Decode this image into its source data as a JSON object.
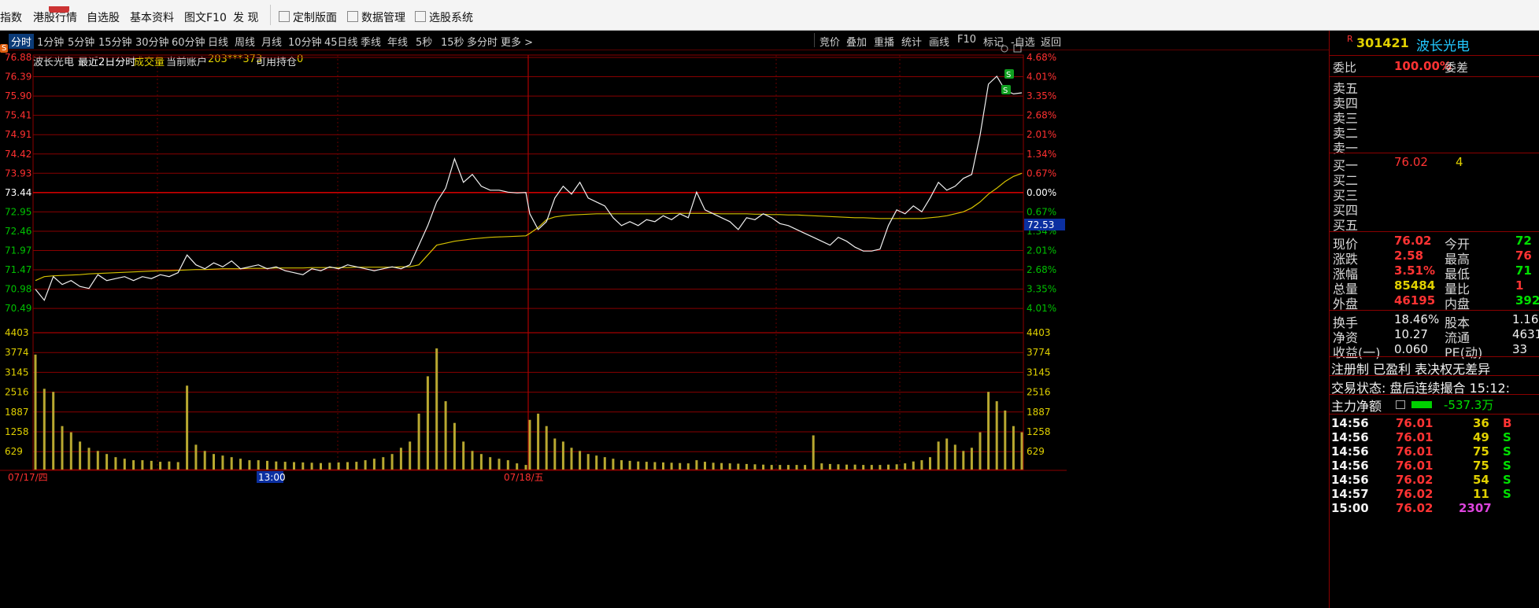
{
  "toolbar": {
    "items": [
      "指数",
      "港股行情",
      "自选股",
      "基本资料",
      "图文F10",
      "发  现",
      "定制版面",
      "数据管理",
      "选股系统"
    ]
  },
  "periods": {
    "items": [
      "分时",
      "1分钟",
      "5分钟",
      "15分钟",
      "30分钟",
      "60分钟",
      "日线",
      "周线",
      "月线",
      "10分钟",
      "45日线",
      "季线",
      "年线",
      "5秒",
      "15秒",
      "多分时",
      "更多 >"
    ],
    "right": [
      "竞价",
      "叠加",
      "重播",
      "统计",
      "画线",
      "F10",
      "标记",
      "-自选",
      "返回"
    ]
  },
  "info": {
    "badge": "S",
    "name": "波长光电",
    "period": "最近2日分时",
    "volume_label": "成交量",
    "account_label": "当前账户",
    "account": "203***373",
    "position_label": "可用持仓",
    "position": "0"
  },
  "chart_data": {
    "type": "line",
    "title": "",
    "price_ticks": [
      "76.88",
      "76.39",
      "75.90",
      "75.41",
      "74.91",
      "74.42",
      "73.93",
      "73.44",
      "72.95",
      "72.46",
      "71.97",
      "71.47",
      "70.98",
      "70.49"
    ],
    "pct_ticks": [
      "4.68%",
      "4.01%",
      "3.35%",
      "2.68%",
      "2.01%",
      "1.34%",
      "0.67%",
      "0.00%",
      "0.67%",
      "1.34%",
      "2.01%",
      "2.68%",
      "3.35%",
      "4.01%"
    ],
    "vol_ticks": [
      "4403",
      "3774",
      "3145",
      "2516",
      "1887",
      "1258",
      "629"
    ],
    "x_labels": [
      "07/17/四",
      "13:00",
      "07/18/五"
    ],
    "ylim": [
      70.49,
      76.88
    ],
    "vol_max": 4403,
    "cursor_price": "72.53",
    "price_series": [
      70.98,
      70.7,
      71.3,
      71.1,
      71.2,
      71.05,
      71.0,
      71.35,
      71.2,
      71.25,
      71.3,
      71.2,
      71.3,
      71.25,
      71.35,
      71.3,
      71.4,
      71.85,
      71.6,
      71.5,
      71.65,
      71.55,
      71.7,
      71.5,
      71.55,
      71.6,
      71.5,
      71.55,
      71.45,
      71.4,
      71.35,
      71.5,
      71.45,
      71.55,
      71.5,
      71.6,
      71.55,
      71.5,
      71.45,
      71.5,
      71.55,
      71.5,
      71.6,
      72.1,
      72.6,
      73.2,
      73.55,
      74.3,
      73.7,
      73.9,
      73.6,
      73.5,
      73.5,
      73.45,
      73.43,
      73.44,
      72.9,
      72.5,
      72.7,
      73.3,
      73.6,
      73.4,
      73.7,
      73.3,
      73.2,
      73.1,
      72.8,
      72.6,
      72.7,
      72.6,
      72.75,
      72.7,
      72.85,
      72.75,
      72.9,
      72.8,
      73.45,
      73.0,
      72.9,
      72.8,
      72.7,
      72.5,
      72.8,
      72.75,
      72.9,
      72.8,
      72.65,
      72.6,
      72.5,
      72.4,
      72.3,
      72.2,
      72.1,
      72.3,
      72.2,
      72.05,
      71.95,
      71.95,
      72.0,
      72.6,
      73.0,
      72.9,
      73.1,
      72.95,
      73.3,
      73.7,
      73.5,
      73.6,
      73.8,
      73.9,
      74.9,
      76.2,
      76.4,
      76.05,
      75.95,
      75.98
    ],
    "avg_series": [
      71.2,
      71.3,
      71.32,
      71.33,
      71.34,
      71.35,
      71.37,
      71.38,
      71.39,
      71.4,
      71.41,
      71.42,
      71.43,
      71.44,
      71.45,
      71.45,
      71.46,
      71.47,
      71.48,
      71.48,
      71.49,
      71.5,
      71.5,
      71.5,
      71.51,
      71.51,
      71.51,
      71.52,
      71.52,
      71.52,
      71.52,
      71.53,
      71.53,
      71.53,
      71.53,
      71.53,
      71.54,
      71.54,
      71.54,
      71.54,
      71.54,
      71.55,
      71.55,
      71.6,
      71.85,
      72.1,
      72.15,
      72.2,
      72.23,
      72.26,
      72.28,
      72.3,
      72.31,
      72.32,
      72.33,
      72.34,
      72.4,
      72.55,
      72.75,
      72.82,
      72.85,
      72.87,
      72.88,
      72.89,
      72.9,
      72.9,
      72.9,
      72.9,
      72.9,
      72.9,
      72.9,
      72.9,
      72.9,
      72.91,
      72.91,
      72.91,
      72.91,
      72.91,
      72.91,
      72.9,
      72.9,
      72.9,
      72.9,
      72.89,
      72.89,
      72.88,
      72.88,
      72.87,
      72.87,
      72.86,
      72.85,
      72.84,
      72.83,
      72.82,
      72.81,
      72.8,
      72.8,
      72.79,
      72.78,
      72.78,
      72.78,
      72.78,
      72.78,
      72.78,
      72.8,
      72.82,
      72.85,
      72.9,
      72.95,
      73.05,
      73.2,
      73.4,
      73.55,
      73.72,
      73.85,
      73.93
    ],
    "volume_series": [
      3700,
      2600,
      2500,
      1400,
      1200,
      900,
      700,
      600,
      500,
      400,
      350,
      300,
      300,
      280,
      250,
      260,
      240,
      2700,
      800,
      600,
      500,
      450,
      400,
      350,
      300,
      300,
      280,
      260,
      250,
      240,
      230,
      220,
      210,
      220,
      230,
      240,
      250,
      300,
      350,
      400,
      500,
      700,
      900,
      1800,
      3000,
      3900,
      2200,
      1500,
      900,
      600,
      500,
      400,
      350,
      300,
      200,
      150,
      1600,
      1800,
      1400,
      1000,
      900,
      700,
      600,
      500,
      450,
      400,
      350,
      300,
      280,
      260,
      250,
      240,
      230,
      220,
      210,
      200,
      300,
      250,
      220,
      210,
      200,
      190,
      180,
      170,
      160,
      150,
      150,
      150,
      150,
      150,
      1100,
      200,
      180,
      170,
      160,
      160,
      150,
      150,
      150,
      160,
      170,
      200,
      260,
      300,
      400,
      900,
      1000,
      800,
      600,
      700,
      1200,
      2500,
      2200,
      1900,
      1400,
      1200
    ]
  },
  "quote": {
    "marker": "R",
    "code": "301421",
    "name": "波长光电",
    "weibi_label": "委比",
    "weibi": "100.00%",
    "weicha_label": "委差",
    "sell_levels": [
      "卖五",
      "卖四",
      "卖三",
      "卖二",
      "卖一"
    ],
    "buy_levels": [
      {
        "label": "买一",
        "price": "76.02",
        "vol": "4"
      },
      {
        "label": "买二",
        "price": "",
        "vol": ""
      },
      {
        "label": "买三",
        "price": "",
        "vol": ""
      },
      {
        "label": "买四",
        "price": "",
        "vol": ""
      },
      {
        "label": "买五",
        "price": "",
        "vol": ""
      }
    ],
    "stats": [
      {
        "l1": "现价",
        "v1": "76.02",
        "c1": "red",
        "l2": "今开",
        "v2": "72",
        "c2": "grn"
      },
      {
        "l1": "涨跌",
        "v1": "2.58",
        "c1": "red",
        "l2": "最高",
        "v2": "76",
        "c2": "red"
      },
      {
        "l1": "涨幅",
        "v1": "3.51%",
        "c1": "red",
        "l2": "最低",
        "v2": "71",
        "c2": "grn"
      },
      {
        "l1": "总量",
        "v1": "85484",
        "c1": "yel",
        "l2": "量比",
        "v2": "1",
        "c2": "red"
      },
      {
        "l1": "外盘",
        "v1": "46195",
        "c1": "red",
        "l2": "内盘",
        "v2": "392",
        "c2": "grn"
      }
    ],
    "stats2": [
      {
        "l1": "换手",
        "v1": "18.46%",
        "l2": "股本",
        "v2": "1.16"
      },
      {
        "l1": "净资",
        "v1": "10.27",
        "l2": "流通",
        "v2": "4631"
      },
      {
        "l1": "收益(一)",
        "v1": "0.060",
        "l2": "PE(动)",
        "v2": "33"
      }
    ],
    "reg_line": "注册制 已盈利 表决权无差异",
    "trade_status": "交易状态: 盘后连续撮合 15:12:",
    "main_net_label": "主力净额",
    "main_net": "-537.3万",
    "ticks": [
      {
        "time": "14:56",
        "price": "76.01",
        "vol": "36",
        "dir": "B"
      },
      {
        "time": "14:56",
        "price": "76.01",
        "vol": "49",
        "dir": "S"
      },
      {
        "time": "14:56",
        "price": "76.01",
        "vol": "75",
        "dir": "S"
      },
      {
        "time": "14:56",
        "price": "76.01",
        "vol": "75",
        "dir": "S"
      },
      {
        "time": "14:56",
        "price": "76.02",
        "vol": "54",
        "dir": "S"
      },
      {
        "time": "14:57",
        "price": "76.02",
        "vol": "11",
        "dir": "S"
      },
      {
        "time": "15:00",
        "price": "76.02",
        "vol": "2307",
        "dir": ""
      }
    ]
  }
}
